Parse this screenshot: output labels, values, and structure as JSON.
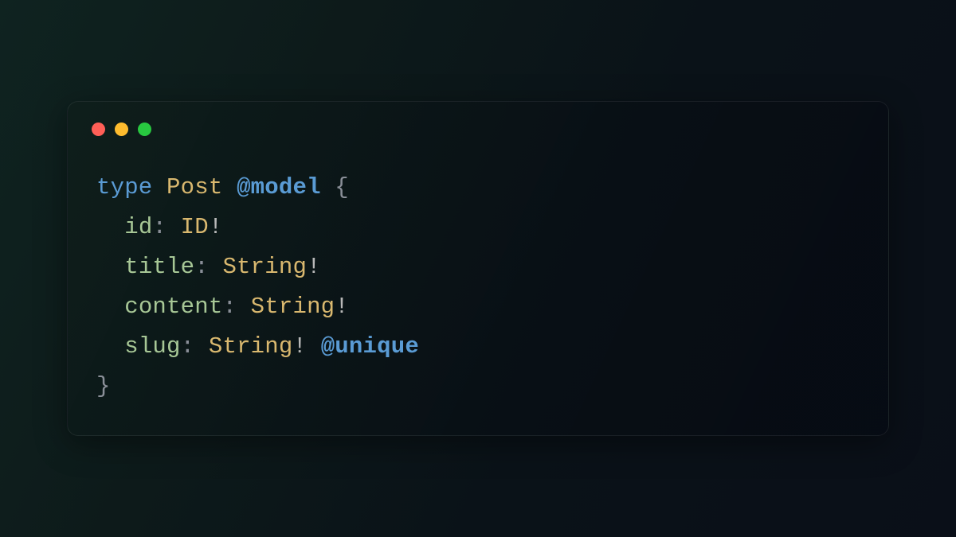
{
  "code": {
    "line1": {
      "keyword": "type",
      "typename": "Post",
      "directive": "@model",
      "brace_open": "{"
    },
    "fields": [
      {
        "name": "id",
        "type": "ID",
        "bang": "!",
        "directive": ""
      },
      {
        "name": "title",
        "type": "String",
        "bang": "!",
        "directive": ""
      },
      {
        "name": "content",
        "type": "String",
        "bang": "!",
        "directive": ""
      },
      {
        "name": "slug",
        "type": "String",
        "bang": "!",
        "directive": "@unique"
      }
    ],
    "brace_close": "}"
  },
  "traffic_lights": [
    "red",
    "yellow",
    "green"
  ]
}
